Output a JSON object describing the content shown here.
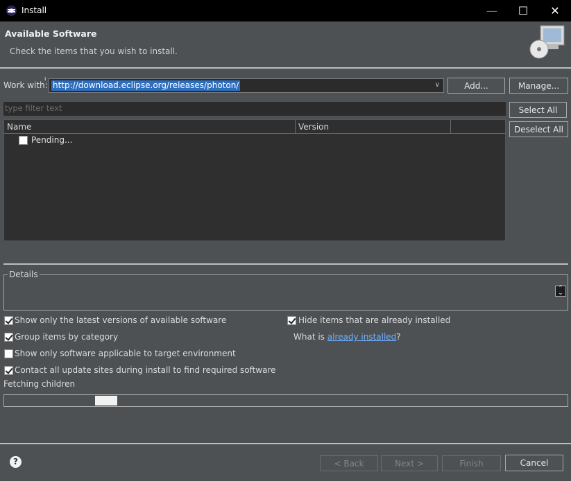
{
  "window": {
    "title": "Install",
    "min": "—",
    "max": "☐",
    "close": "✕"
  },
  "header": {
    "title": "Available Software",
    "subtitle": "Check the items that you wish to install."
  },
  "workwith": {
    "label": "Work with:",
    "value": "http://download.eclipse.org/releases/photon/",
    "add": "Add...",
    "manage": "Manage..."
  },
  "filter": {
    "placeholder": "type filter text"
  },
  "table": {
    "columns": [
      "Name",
      "Version"
    ],
    "rows": [
      {
        "name": "Pending...",
        "checked": false
      }
    ]
  },
  "side_buttons": {
    "select_all": "Select All",
    "deselect_all": "Deselect All"
  },
  "details": {
    "label": "Details"
  },
  "options": {
    "latest_versions": {
      "label": "Show only the latest versions of available software",
      "checked": true
    },
    "group_by_category": {
      "label": "Group items by category",
      "checked": true
    },
    "target_env": {
      "label": "Show only software applicable to target environment",
      "checked": false
    },
    "contact_sites": {
      "label": "Contact all update sites during install to find required software",
      "checked": true
    },
    "hide_installed": {
      "label": "Hide items that are already installed",
      "checked": true
    },
    "what_is_prefix": "What is ",
    "already_installed_link": "already installed",
    "what_is_suffix": "?"
  },
  "status": {
    "text": "Fetching children"
  },
  "footer": {
    "help": "?",
    "back": "< Back",
    "next": "Next >",
    "finish": "Finish",
    "cancel": "Cancel"
  }
}
